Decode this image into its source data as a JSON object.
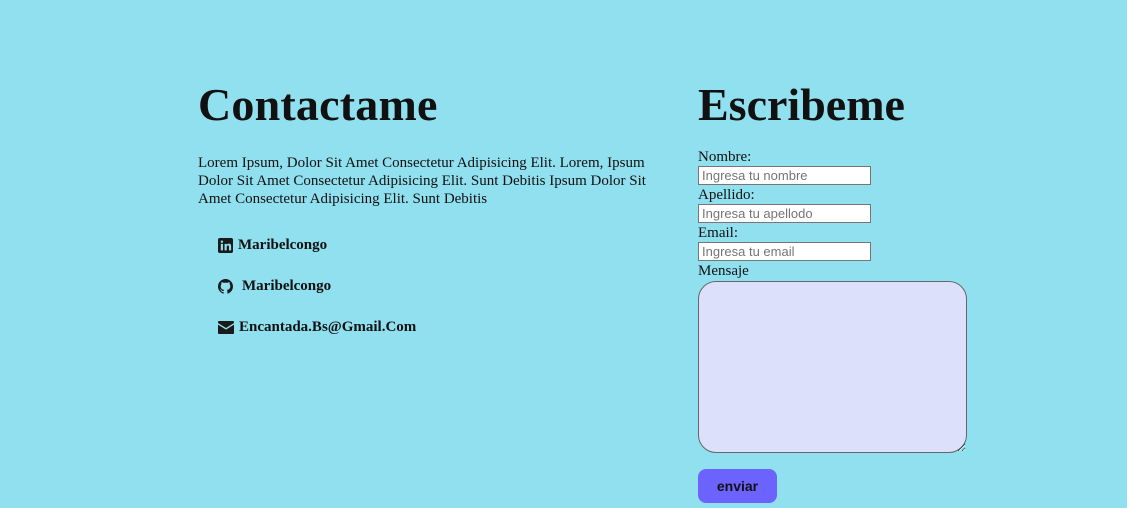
{
  "contact": {
    "title": "Contactame",
    "description": "Lorem Ipsum, Dolor Sit Amet Consectetur Adipisicing Elit. Lorem, Ipsum Dolor Sit Amet Consectetur Adipisicing Elit. Sunt Debitis Ipsum Dolor Sit Amet Consectetur Adipisicing Elit. Sunt Debitis",
    "links": [
      {
        "icon": "linkedin-icon",
        "label": "Maribelcongo"
      },
      {
        "icon": "github-icon",
        "label": "Maribelcongo"
      },
      {
        "icon": "envelope-icon",
        "label": "Encantada.Bs@Gmail.Com"
      }
    ]
  },
  "form": {
    "title": "Escribeme",
    "name_label": "Nombre:",
    "name_placeholder": "Ingresa tu nombre",
    "lastname_label": "Apellido:",
    "lastname_placeholder": "Ingresa tu apellodo",
    "email_label": "Email:",
    "email_placeholder": "Ingresa tu email",
    "message_label": "Mensaje",
    "submit_label": "enviar"
  },
  "colors": {
    "background": "#90e0ef",
    "textarea_bg": "#dde0fa",
    "button_bg": "#6c63ff"
  }
}
